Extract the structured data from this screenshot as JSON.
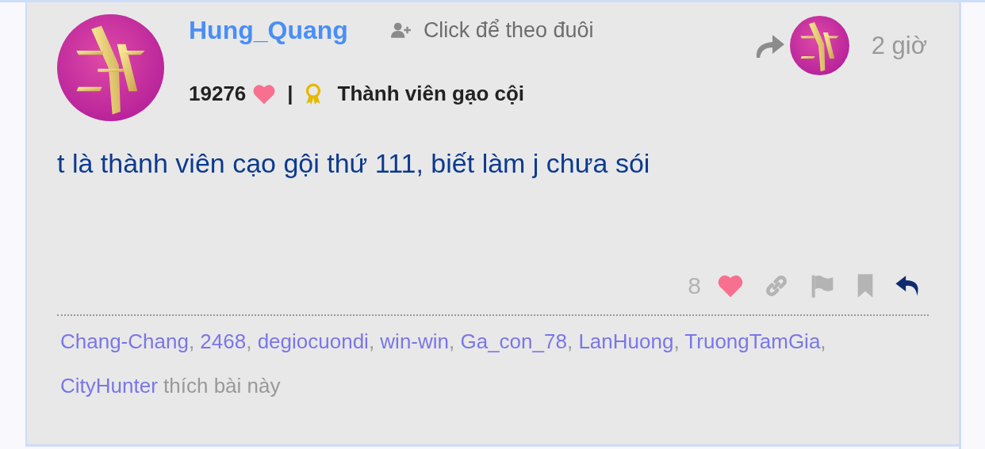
{
  "post": {
    "author": {
      "name": "Hung_Quang",
      "follow_label": "Click để theo đuôi",
      "points": "19276",
      "separator": "|",
      "rank": "Thành viên gạo cội"
    },
    "time": "2 giờ",
    "text": "t là thành viên cạo gội thứ 111, biết làm j chưa sói",
    "like_count": "8",
    "likers": [
      {
        "name": "Chang-Chang",
        "sep": ","
      },
      {
        "name": "2468",
        "sep": ","
      },
      {
        "name": "degiocuondi",
        "sep": ","
      },
      {
        "name": "win-win",
        "sep": ","
      },
      {
        "name": "Ga_con_78",
        "sep": ","
      },
      {
        "name": "LanHuong",
        "sep": ","
      },
      {
        "name": "TruongTamGia",
        "sep": ","
      },
      {
        "name": "CityHunter"
      }
    ],
    "likes_suffix": "thích bài này"
  }
}
